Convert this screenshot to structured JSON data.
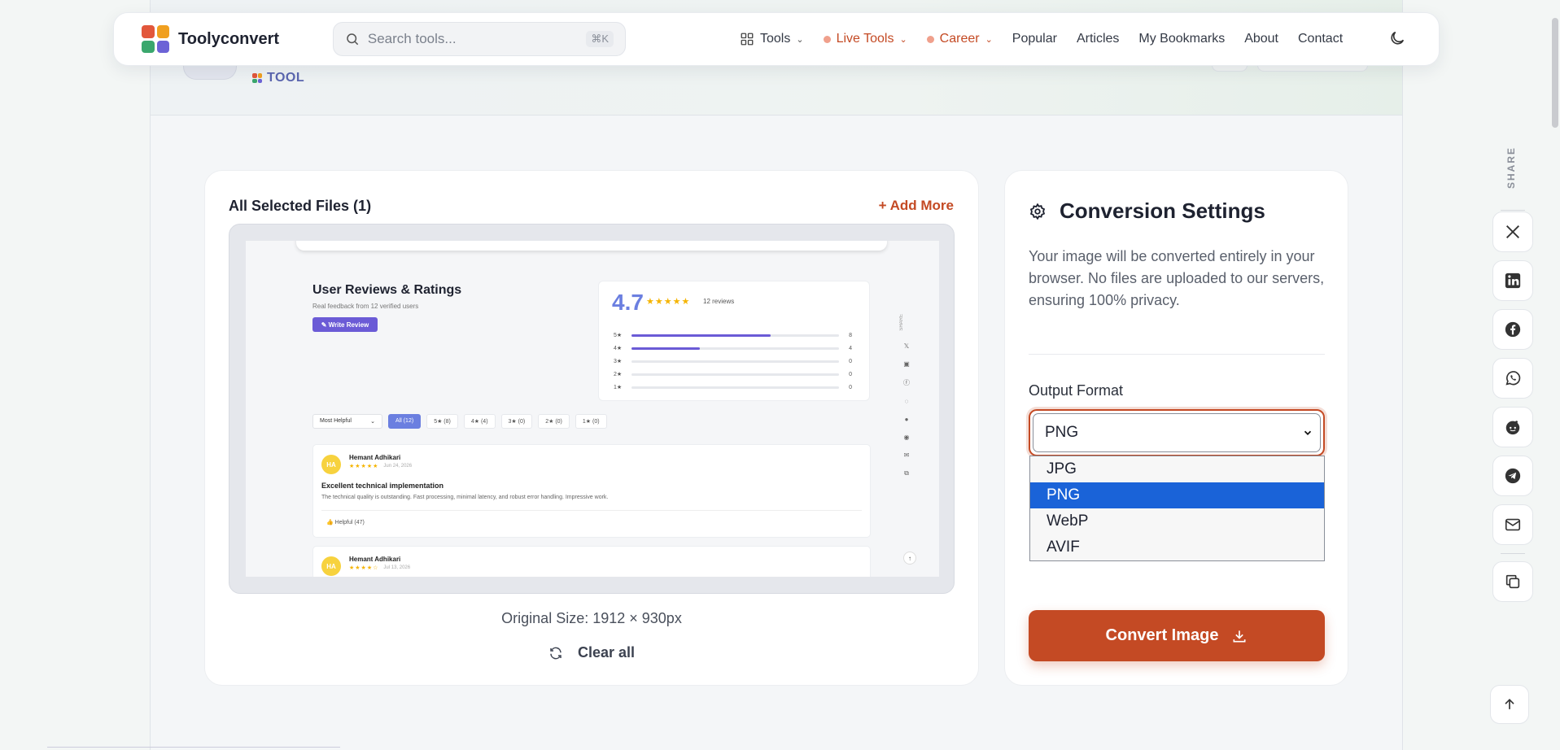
{
  "colors": {
    "accent": "#c44a24",
    "selected_option": "#1a63d8",
    "tool_tag": "#5b66b0",
    "logo": [
      "#e2573b",
      "#f0a020",
      "#3aa76d",
      "#6c63d6"
    ]
  },
  "navbar": {
    "brand": "Toolyconvert",
    "search_placeholder": "Search tools...",
    "search_shortcut": "⌘K",
    "items": [
      {
        "label": "Tools",
        "icon": "grid-icon",
        "has_dropdown": true
      },
      {
        "label": "Live Tools",
        "accent": true,
        "has_dropdown": true
      },
      {
        "label": "Career",
        "accent": true,
        "has_dropdown": true
      },
      {
        "label": "Popular"
      },
      {
        "label": "Articles"
      },
      {
        "label": "My Bookmarks"
      },
      {
        "label": "About"
      },
      {
        "label": "Contact"
      }
    ],
    "theme_icon": "moon-icon"
  },
  "page_header": {
    "tag": "TOOL"
  },
  "files": {
    "title": "All Selected Files (1)",
    "add_more": "+ Add More",
    "original_size": "Original Size: 1912 × 930px",
    "clear_all": "Clear all",
    "preview": {
      "heading": "User Reviews & Ratings",
      "subheading": "Real feedback from 12 verified users",
      "write_review": "✎ Write Review",
      "score": "4.7",
      "stars": "★★★★★",
      "review_count": "12 reviews",
      "bars": [
        {
          "label": "5★",
          "count": "8",
          "fill": 0.67
        },
        {
          "label": "4★",
          "count": "4",
          "fill": 0.33
        },
        {
          "label": "3★",
          "count": "0",
          "fill": 0
        },
        {
          "label": "2★",
          "count": "0",
          "fill": 0
        },
        {
          "label": "1★",
          "count": "0",
          "fill": 0
        }
      ],
      "share_label": "SHARE",
      "sort": "Most Helpful",
      "filter_chips": [
        "All (12)",
        "5★ (8)",
        "4★ (4)",
        "3★ (0)",
        "2★ (0)",
        "1★ (0)"
      ],
      "reviews": [
        {
          "initials": "HA",
          "name": "Hemant Adhikari",
          "stars": "★★★★★",
          "date": "Jun 24, 2026",
          "title": "Excellent technical implementation",
          "body": "The technical quality is outstanding. Fast processing, minimal latency, and robust error handling. Impressive work.",
          "helpful": "👍 Helpful (47)"
        },
        {
          "initials": "HA",
          "name": "Hemant Adhikari",
          "stars": "★★★★☆",
          "date": "Jul 13, 2026"
        }
      ]
    }
  },
  "settings": {
    "title": "Conversion Settings",
    "description": "Your image will be converted entirely in your browser. No files are uploaded to our servers, ensuring 100% privacy.",
    "output_format_label": "Output Format",
    "selected_format": "PNG",
    "options": [
      "JPG",
      "PNG",
      "WebP",
      "AVIF"
    ],
    "convert_label": "Convert Image"
  },
  "share": {
    "label": "SHARE",
    "buttons": [
      "x-icon",
      "linkedin-icon",
      "facebook-icon",
      "whatsapp-icon",
      "reddit-icon",
      "telegram-icon",
      "email-icon",
      "copy-link-icon"
    ]
  }
}
